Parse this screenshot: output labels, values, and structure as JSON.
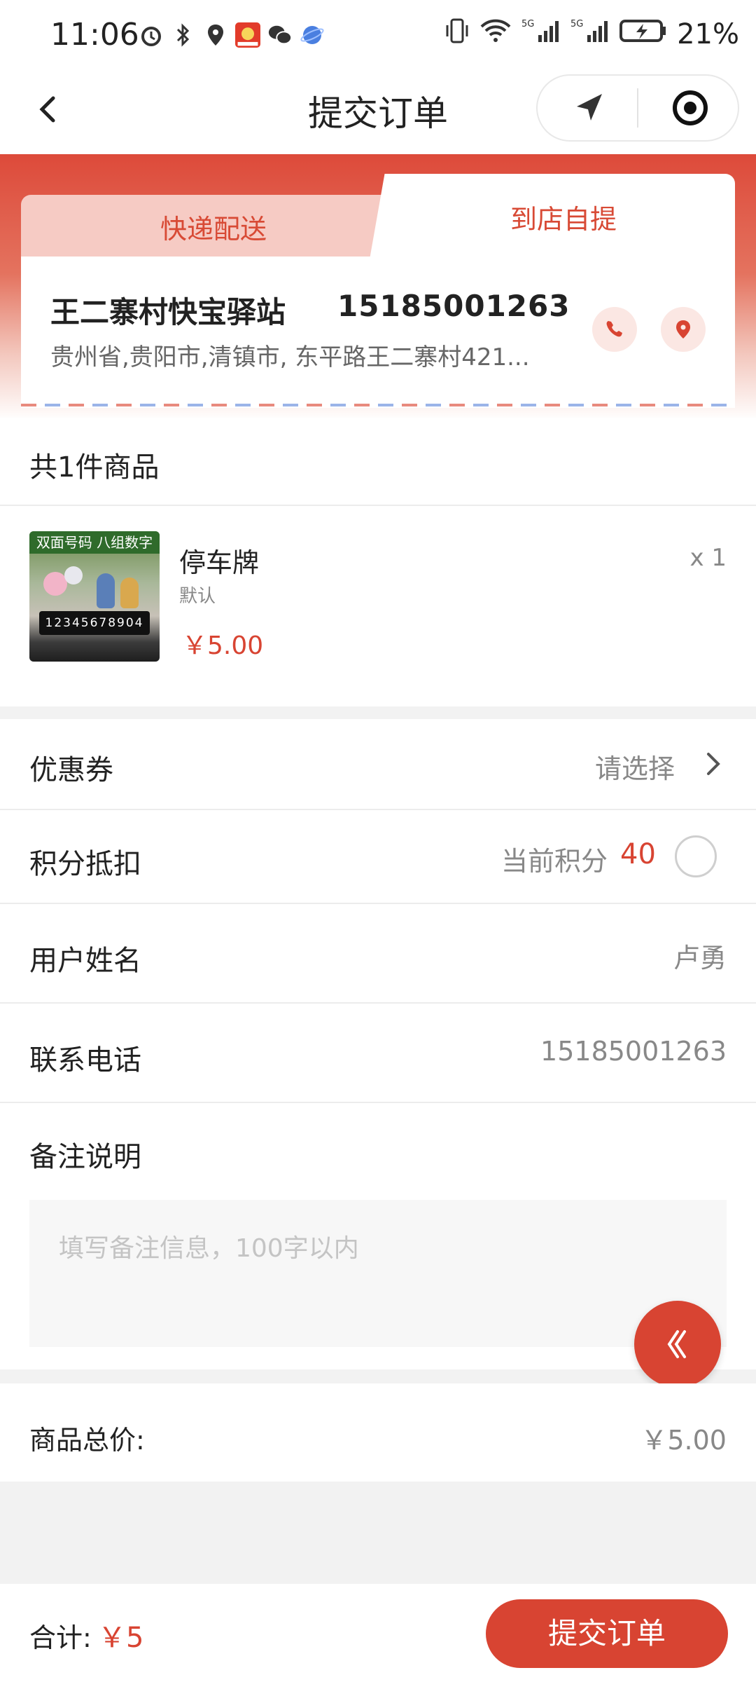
{
  "status_bar": {
    "time": "11:06",
    "battery": "21%"
  },
  "nav": {
    "title": "提交订单"
  },
  "delivery_tabs": {
    "express": "快递配送",
    "pickup": "到店自提",
    "selected": "pickup"
  },
  "store": {
    "name": "王二寨村快宝驿站",
    "phone": "15185001263",
    "address": "贵州省,贵阳市,清镇市, 东平路王二寨村421..."
  },
  "items_section": {
    "count_label": "共1件商品"
  },
  "product": {
    "name": "停车牌",
    "spec": "默认",
    "price": "￥5.00",
    "qty": "x 1",
    "image_banner": "双面号码 八组数字",
    "image_plate": "12345678904"
  },
  "coupon": {
    "label": "优惠券",
    "value": "请选择"
  },
  "points": {
    "label": "积分抵扣",
    "prefix": "当前积分",
    "value": "40",
    "checked": false
  },
  "user_name": {
    "label": "用户姓名",
    "value": "卢勇"
  },
  "contact_phone": {
    "label": "联系电话",
    "value": "15185001263"
  },
  "remark": {
    "label": "备注说明",
    "placeholder": "填写备注信息，100字以内"
  },
  "goods_total": {
    "label": "商品总价:",
    "value": "￥5.00"
  },
  "footer": {
    "total_label": "合计:",
    "total_value": "￥5",
    "submit_label": "提交订单"
  },
  "colors": {
    "accent": "#d84432",
    "banner_top": "#dd4a3a"
  }
}
